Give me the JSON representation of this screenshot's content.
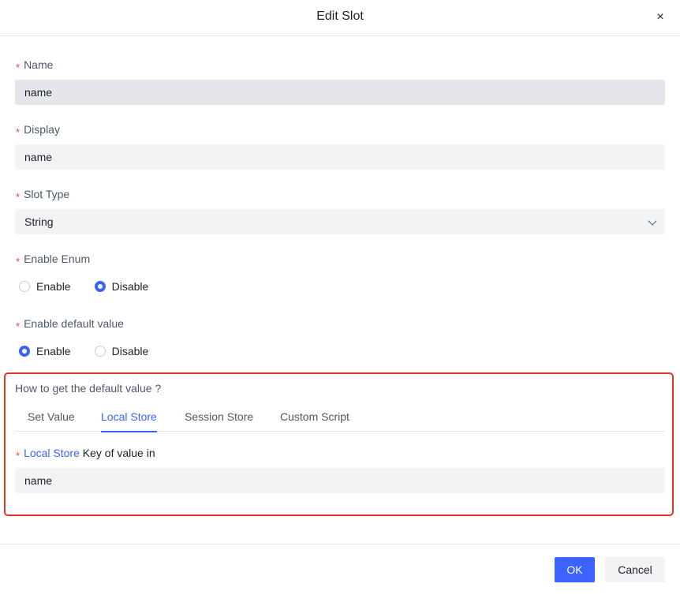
{
  "dialog": {
    "title": "Edit Slot",
    "close_glyph": "×"
  },
  "form": {
    "required_mark": "*",
    "name": {
      "label": "Name",
      "value": "name"
    },
    "display": {
      "label": "Display",
      "value": "name"
    },
    "slot_type": {
      "label": "Slot Type",
      "value": "String"
    },
    "enable_enum": {
      "label": "Enable Enum",
      "options": [
        "Enable",
        "Disable"
      ],
      "selected": "Disable"
    },
    "enable_default": {
      "label": "Enable default value",
      "options": [
        "Enable",
        "Disable"
      ],
      "selected": "Enable"
    },
    "default_source": {
      "label": "How to get the default value ?",
      "tabs": [
        "Set Value",
        "Local Store",
        "Session Store",
        "Custom Script"
      ],
      "active_tab": "Local Store",
      "key_label_link": "Local Store",
      "key_label_rest": " Key of value in",
      "key_value": "name"
    }
  },
  "footer": {
    "ok_label": "OK",
    "cancel_label": "Cancel"
  },
  "colors": {
    "accent": "#3c63ff",
    "required": "#f53f3f",
    "highlight_border": "#e43326"
  }
}
